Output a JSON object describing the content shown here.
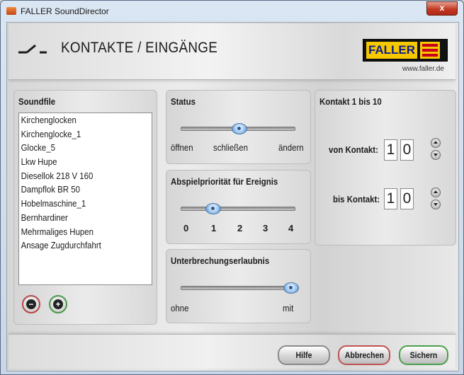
{
  "window": {
    "title": "FALLER SoundDirector",
    "close_label": "x"
  },
  "header": {
    "title": "KONTAKTE / EINGÄNGE",
    "logo_text": "FALLER",
    "url": "www.faller.de"
  },
  "soundfile": {
    "title": "Soundfile",
    "items": [
      "Kirchenglocken",
      "Kirchenglocke_1",
      "Glocke_5",
      "Lkw Hupe",
      "Diesellok 218 V 160",
      "Dampflok BR 50",
      "Hobelmaschine_1",
      "Bernhardiner",
      "Mehrmaliges Hupen",
      "Ansage Zugdurchfahrt"
    ],
    "remove_label": "−",
    "add_label": "+"
  },
  "status": {
    "title": "Status",
    "labels": [
      "öffnen",
      "schließen",
      "ändern"
    ],
    "selected": "schließen"
  },
  "priority": {
    "title": "Abspielpriorität für Ereignis",
    "ticks": [
      "0",
      "1",
      "2",
      "3",
      "4"
    ],
    "value": 1
  },
  "interrupt": {
    "title": "Unterbrechungserlaubnis",
    "labels": [
      "ohne",
      "mit"
    ],
    "selected": "mit"
  },
  "kontakt": {
    "title": "Kontakt 1 bis 10",
    "von_label": "von Kontakt:",
    "von_digits": [
      "1",
      "0"
    ],
    "bis_label": "bis Kontakt:",
    "bis_digits": [
      "1",
      "0"
    ]
  },
  "footer": {
    "help_label": "Hilfe",
    "cancel_label": "Abbrechen",
    "save_label": "Sichern"
  },
  "colors": {
    "accent_thumb": "#3a78c0",
    "cancel_border": "#c05050",
    "save_border": "#4aa04a",
    "logo_yellow": "#f6c800"
  }
}
